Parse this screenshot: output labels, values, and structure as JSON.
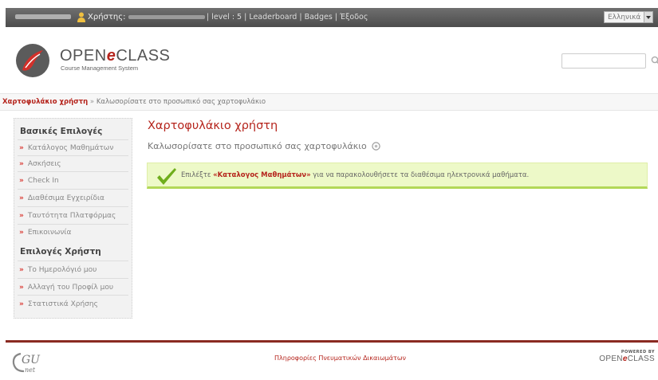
{
  "topbar": {
    "user_label": "Χρήστης:",
    "links_text": "| level : 5 | Leaderboard | Badges | Έξοδος",
    "language": "Ελληνικά"
  },
  "header": {
    "brand_prefix": "OPEN",
    "brand_e": "e",
    "brand_suffix": "CLASS",
    "brand_subtitle": "Course Management System",
    "search_value": ""
  },
  "breadcrumb": {
    "home": "Χαρτοφυλάκιο χρήστη",
    "separator": "»",
    "current": "Καλωσορίσατε στο προσωπικό σας χαρτοφυλάκιο"
  },
  "sidebar": {
    "basic_heading": "Βασικές Επιλογές",
    "basic_items": [
      "Κατάλογος Μαθημάτων",
      "Ασκήσεις",
      "Check In",
      "Διαθέσιμα Εγχειρίδια",
      "Ταυτότητα Πλατφόρμας",
      "Επικοινωνία"
    ],
    "user_heading": "Επιλογές Χρήστη",
    "user_items": [
      "Το Ημερολόγιό μου",
      "Αλλαγή του Προφίλ μου",
      "Στατιστικά Χρήσης"
    ]
  },
  "content": {
    "title": "Χαρτοφυλάκιο χρήστη",
    "welcome": "Καλωσορίσατε στο προσωπικό σας χαρτοφυλάκιο",
    "alert_pre": "Επιλέξτε ",
    "alert_bold": "«Καταλογος Μαθημάτων»",
    "alert_post": " για να παρακολουθήσετε τα διαθέσιμα ηλεκτρονικά μαθήματα."
  },
  "footer": {
    "link": "Πληροφορίες Πνευματικών Δικαιωμάτων",
    "logo_text": "GU",
    "logo_sub": "net",
    "powered_by": "POWERED BY",
    "brand_prefix": "OPEN",
    "brand_e": "e",
    "brand_suffix": "CLASS"
  },
  "colors": {
    "accent": "#b5241c",
    "alert_bg": "#edf9c8",
    "alert_border": "#b2d858"
  },
  "icons": [
    "user-icon",
    "search-icon",
    "help-icon",
    "check-icon",
    "dropdown-arrow-icon"
  ]
}
